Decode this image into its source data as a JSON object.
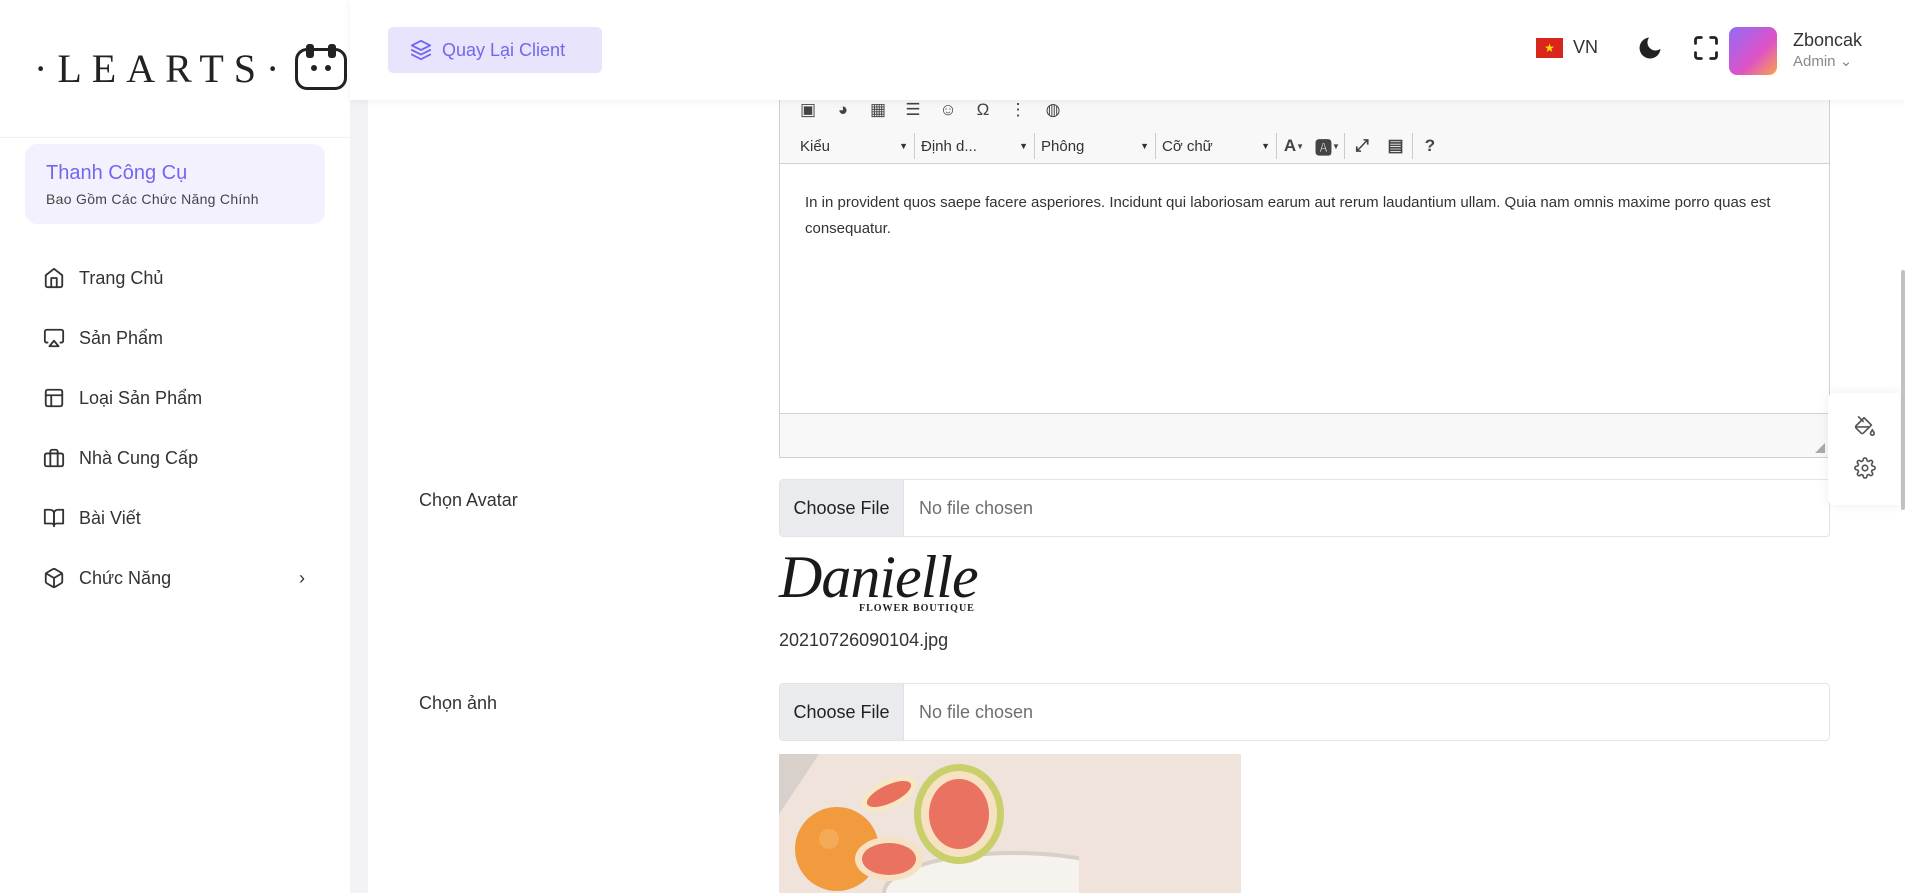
{
  "brand": {
    "logo_text": "·LEARTS·"
  },
  "sidebar": {
    "promo_title": "Thanh Công Cụ",
    "promo_subtitle": "Bao Gồm Các Chức Năng Chính",
    "items": [
      {
        "label": "Trang Chủ",
        "icon": "home-icon"
      },
      {
        "label": "Sản Phẩm",
        "icon": "airplay-icon"
      },
      {
        "label": "Loại Sản Phẩm",
        "icon": "layout-icon"
      },
      {
        "label": "Nhà Cung Cấp",
        "icon": "briefcase-icon"
      },
      {
        "label": "Bài Viết",
        "icon": "book-open-icon"
      },
      {
        "label": "Chức Năng",
        "icon": "box-icon",
        "has_submenu": true
      }
    ]
  },
  "topbar": {
    "back_label": "Quay Lại Client",
    "language": "VN",
    "user_name": "Zboncak",
    "user_role": "Admin"
  },
  "editor": {
    "toolbar_combos": [
      "Kiểu",
      "Định d...",
      "Phông",
      "Cỡ chữ"
    ],
    "content": "In in provident quos saepe facere asperiores. Incidunt qui laboriosam earum aut rerum laudantium ullam. Quia nam omnis maxime porro quas est consequatur."
  },
  "form": {
    "avatar_label": "Chọn Avatar",
    "avatar_file_button": "Choose File",
    "avatar_no_file": "No file chosen",
    "avatar_preview_script": "Danielle",
    "avatar_preview_sub": "FLOWER BOUTIQUE",
    "avatar_filename": "20210726090104.jpg",
    "image_label": "Chọn ảnh",
    "image_file_button": "Choose File",
    "image_no_file": "No file chosen"
  },
  "colors": {
    "accent": "#7367f0",
    "accent_light": "#e7e4fc",
    "flag_red": "#da251d"
  }
}
